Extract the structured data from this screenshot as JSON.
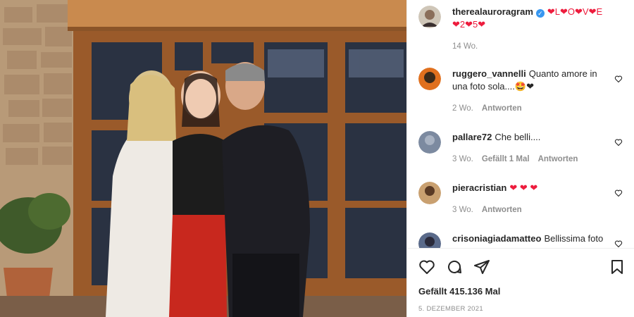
{
  "caption": {
    "username": "therealauroragram",
    "text_line1": "❤L❤O❤V❤E",
    "text_line2": "❤2❤5❤",
    "age": "14 Wo."
  },
  "comments": [
    {
      "username": "ruggero_vannelli",
      "text": "Quanto amore in una foto sola....🤩❤",
      "age": "2 Wo.",
      "likes_label": "",
      "reply": "Antworten"
    },
    {
      "username": "pallare72",
      "text": "Che belli....",
      "age": "3 Wo.",
      "likes_label": "Gefällt 1 Mal",
      "reply": "Antworten"
    },
    {
      "username": "pieracristian",
      "text": "❤ ❤ ❤",
      "age": "3 Wo.",
      "likes_label": "",
      "reply": "Antworten"
    },
    {
      "username": "crisoniagiadamatteo",
      "text": "Bellissima foto"
    }
  ],
  "actions": {
    "likes_text": "Gefällt 415.136 Mal",
    "date_text": "5. Dezember 2021"
  },
  "colors": {
    "verified": "#3897f0",
    "heart": "#ed1c3d",
    "text": "#262626",
    "muted": "#8e8e8e"
  },
  "icons": [
    "verified-icon",
    "heart-icon",
    "comment-icon",
    "share-icon",
    "bookmark-icon"
  ]
}
